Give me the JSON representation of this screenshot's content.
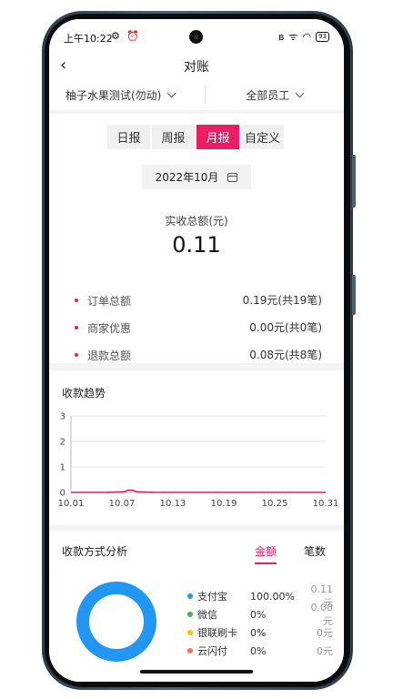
{
  "status": {
    "time": "上午10:22",
    "left_icons": "⚙ ⏰",
    "signal": "ᯤ",
    "wifi": "◠",
    "battery": "93"
  },
  "header": {
    "back": "‹",
    "title": "对账"
  },
  "filters": {
    "store": "柚子水果测试(勿动)",
    "staff": "全部员工"
  },
  "tabs": [
    {
      "label": "日报",
      "active": false
    },
    {
      "label": "周报",
      "active": false
    },
    {
      "label": "月报",
      "active": true
    },
    {
      "label": "自定义",
      "active": false
    }
  ],
  "date": "2022年10月",
  "summary": {
    "total_label": "实收总额(元)",
    "total_value": "0.11",
    "rows": [
      {
        "label": "订单总额",
        "value": "0.19元(共19笔)"
      },
      {
        "label": "商家优惠",
        "value": "0.00元(共0笔)"
      },
      {
        "label": "退款总额",
        "value": "0.08元(共8笔)"
      }
    ]
  },
  "trend": {
    "title": "收款趋势"
  },
  "chart_data": {
    "type": "line",
    "title": "收款趋势",
    "x": [
      "10.01",
      "10.03",
      "10.05",
      "10.07",
      "10.08",
      "10.09",
      "10.11",
      "10.13",
      "10.19",
      "10.25",
      "10.31"
    ],
    "xticks": [
      "10.01",
      "10.07",
      "10.13",
      "10.19",
      "10.25",
      "10.31"
    ],
    "yticks": [
      "0",
      "1",
      "2",
      "3"
    ],
    "ylim": [
      0,
      3
    ],
    "series": [
      {
        "values": [
          0,
          0,
          0,
          0.02,
          0.09,
          0.02,
          0,
          0,
          0,
          0,
          0
        ]
      }
    ],
    "color": "#e91e63",
    "grid": true
  },
  "payment": {
    "title": "收款方式分析",
    "tabs": [
      {
        "label": "金额",
        "active": true
      },
      {
        "label": "笔数",
        "active": false
      }
    ],
    "methods": [
      {
        "name": "支付宝",
        "pct": "100.00%",
        "amount": "0.11元",
        "color": "#2196f3"
      },
      {
        "name": "微信",
        "pct": "0%",
        "amount": "0.00元",
        "color": "#4caf50"
      },
      {
        "name": "银联刷卡",
        "pct": "0%",
        "amount": "0元",
        "color": "#ffc107"
      },
      {
        "name": "云闪付",
        "pct": "0%",
        "amount": "0元",
        "color": "#ff7043"
      }
    ]
  }
}
